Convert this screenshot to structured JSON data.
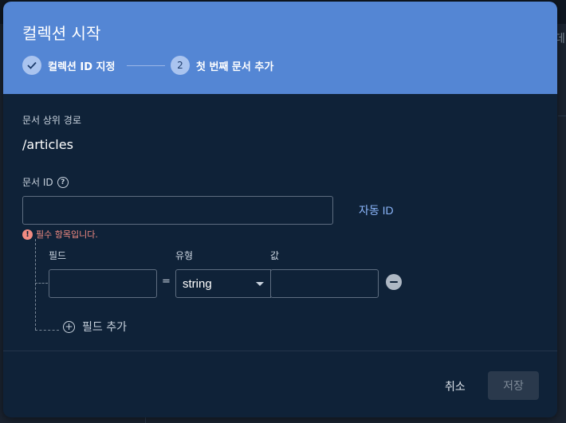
{
  "background": {
    "right_edge_text": "데이"
  },
  "dialog": {
    "title": "컬렉션 시작",
    "steps": [
      {
        "number": "1",
        "label": "컬렉션 ID 지정",
        "state": "completed"
      },
      {
        "number": "2",
        "label": "첫 번째 문서 추가",
        "state": "active"
      }
    ],
    "parent_path_label": "문서 상위 경로",
    "parent_path_value": "/articles",
    "doc_id_label": "문서 ID",
    "doc_id_value": "",
    "auto_id_label": "자동 ID",
    "error_message": "필수 항목입니다.",
    "fields": {
      "col_field": "필드",
      "col_type": "유형",
      "col_value": "값",
      "equals": "=",
      "row": {
        "field_value": "",
        "type_value": "string",
        "value_value": ""
      },
      "add_field_label": "필드 추가"
    },
    "actions": {
      "cancel": "취소",
      "save": "저장"
    }
  },
  "colors": {
    "header_bg": "#5486d4",
    "dialog_bg": "#0f2238",
    "link": "#8ab4f8",
    "error": "#f28b82"
  },
  "icons": [
    "check-icon",
    "help-icon",
    "error-icon",
    "caret-down-icon",
    "remove-icon",
    "add-circle-icon"
  ]
}
